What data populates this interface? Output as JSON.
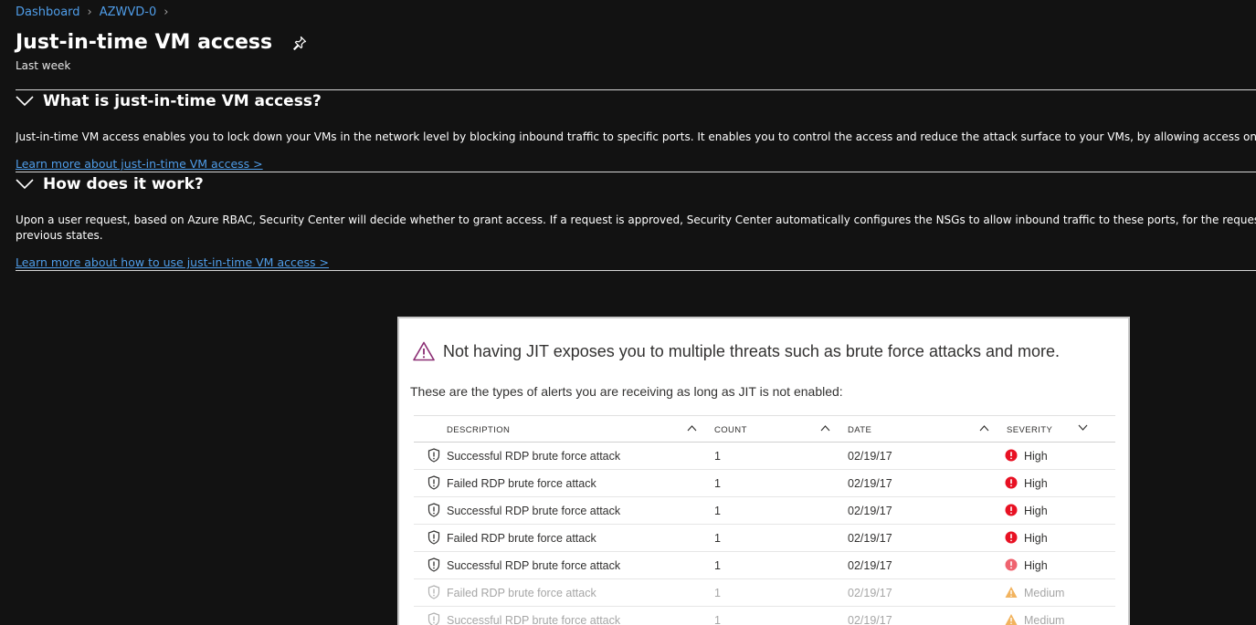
{
  "breadcrumb": {
    "items": [
      "Dashboard",
      "AZWVD-0"
    ]
  },
  "header": {
    "title": "Just-in-time VM access",
    "subtitle": "Last week"
  },
  "sections": [
    {
      "heading": "What is just-in-time VM access?",
      "text": "Just-in-time VM access enables you to lock down your VMs in the network level by blocking inbound traffic to specific ports. It enables you to control the access and reduce the attack surface to your VMs, by allowing access only upon a specific need.",
      "link": "Learn more about just-in-time VM access >"
    },
    {
      "heading": "How does it work?",
      "text_line1": "Upon a user request, based on Azure RBAC, Security Center will decide whether to grant access. If a request is approved, Security Center automatically configures the NSGs to allow inbound traffic to these ports, for the requested amount of time, after which it restores the NSGs to their",
      "text_line2": "previous states.",
      "link": "Learn more about how to use just-in-time VM access >"
    }
  ],
  "illustration": {
    "warning": "Not having JIT exposes you to multiple threats such as brute force attacks and more.",
    "subtext": "These are the types of alerts you are receiving as long as JIT is not enabled:",
    "columns": [
      "DESCRIPTION",
      "COUNT",
      "DATE",
      "SEVERITY"
    ],
    "rows": [
      {
        "description": "Successful RDP brute force attack",
        "count": "1",
        "date": "02/19/17",
        "severity": "High"
      },
      {
        "description": "Failed RDP brute force attack",
        "count": "1",
        "date": "02/19/17",
        "severity": "High"
      },
      {
        "description": "Successful RDP brute force attack",
        "count": "1",
        "date": "02/19/17",
        "severity": "High"
      },
      {
        "description": "Failed RDP brute force attack",
        "count": "1",
        "date": "02/19/17",
        "severity": "High"
      },
      {
        "description": "Successful RDP brute force attack",
        "count": "1",
        "date": "02/19/17",
        "severity": "High"
      },
      {
        "description": "Failed RDP brute force attack",
        "count": "1",
        "date": "02/19/17",
        "severity": "Medium"
      },
      {
        "description": "Successful RDP brute force attack",
        "count": "1",
        "date": "02/19/17",
        "severity": "Medium"
      }
    ]
  },
  "colors": {
    "background": "#121212",
    "link": "#4f9de9",
    "high": "#e81123",
    "medium": "#f2b35e",
    "warning_icon": "#8b2d73"
  }
}
